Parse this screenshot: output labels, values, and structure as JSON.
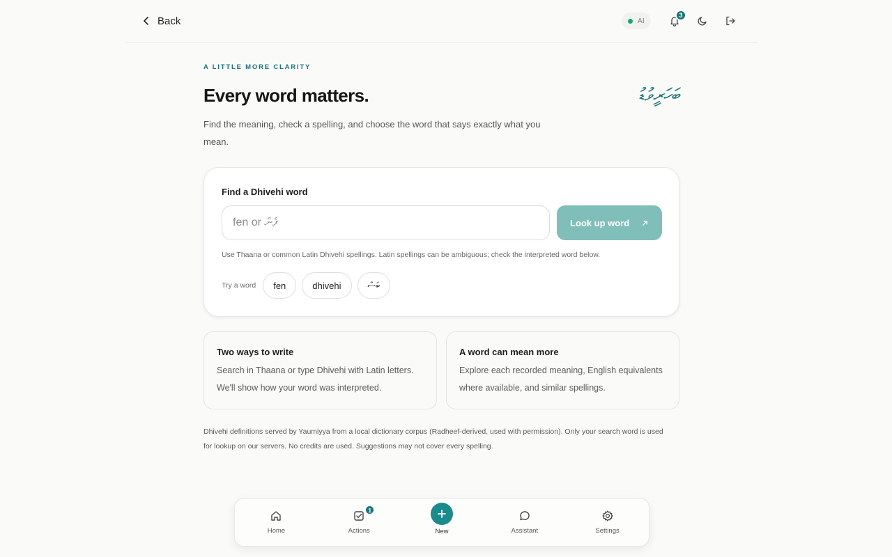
{
  "header": {
    "back_label": "Back",
    "ai_label": "AI",
    "notification_count": "3"
  },
  "hero": {
    "eyebrow": "A LITTLE MORE CLARITY",
    "title": "Every word matters.",
    "thaana_mark": "ބަހަރީވުޑު",
    "subtitle": "Find the meaning, check a spelling, and choose the word that says exactly what you mean."
  },
  "search": {
    "label": "Find a Dhivehi word",
    "placeholder": "fen or ފެން",
    "value": "",
    "button_label": "Look up word",
    "hint": "Use Thaana or common Latin Dhivehi spellings. Latin spellings can be ambiguous; check the interpreted word below.",
    "try_label": "Try a word",
    "suggestions": [
      "fen",
      "dhivehi",
      "ބަސް"
    ]
  },
  "info_cards": [
    {
      "title": "Two ways to write",
      "body": "Search in Thaana or type Dhivehi with Latin letters. We'll show how your word was interpreted."
    },
    {
      "title": "A word can mean more",
      "body": "Explore each recorded meaning, English equivalents where available, and similar spellings."
    }
  ],
  "footnote": "Dhivehi definitions served by Yaumiyya from a local dictionary corpus (Radheef-derived, used with permission). Only your search word is used for lookup on our servers. No credits are used. Suggestions may not cover every spelling.",
  "bottom_nav": {
    "items": [
      {
        "label": "Home",
        "icon": "home-icon"
      },
      {
        "label": "Actions",
        "icon": "checkbox-icon",
        "badge": "1"
      },
      {
        "label": "New",
        "icon": "plus-icon"
      },
      {
        "label": "Assistant",
        "icon": "chat-bubble-icon"
      },
      {
        "label": "Settings",
        "icon": "gear-icon"
      }
    ]
  },
  "colors": {
    "accent": "#1b7477",
    "button_disabled": "#7fbeb9",
    "ai_status": "#18a673"
  }
}
